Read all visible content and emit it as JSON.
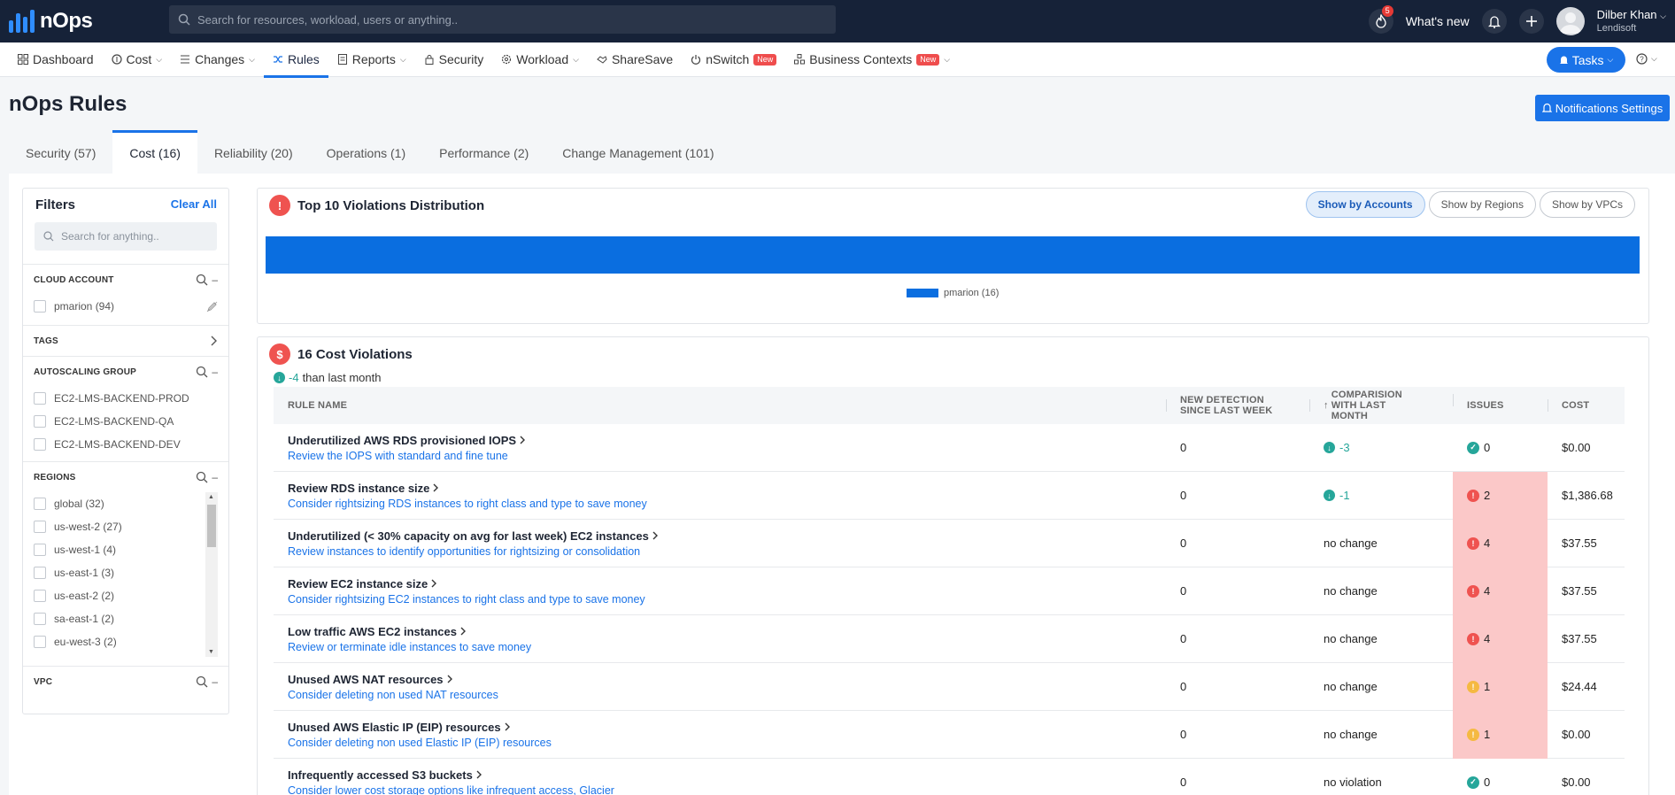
{
  "topbar": {
    "brand": "nOps",
    "search_placeholder": "Search for resources, workload, users or anything..",
    "notifications_count": "5",
    "whats_new": "What's new",
    "user_name": "Dilber Khan",
    "user_org": "Lendisoft"
  },
  "nav": {
    "items": [
      {
        "label": "Dashboard",
        "icon": "grid-icon"
      },
      {
        "label": "Cost",
        "icon": "coin-icon"
      },
      {
        "label": "Changes",
        "icon": "list-icon"
      },
      {
        "label": "Rules",
        "icon": "shuffle-icon"
      },
      {
        "label": "Reports",
        "icon": "report-icon"
      },
      {
        "label": "Security",
        "icon": "lock-icon"
      },
      {
        "label": "Workload",
        "icon": "gear-icon"
      },
      {
        "label": "ShareSave",
        "icon": "handshake-icon"
      },
      {
        "label": "nSwitch",
        "icon": "power-icon"
      },
      {
        "label": "Business Contexts",
        "icon": "cluster-icon"
      }
    ],
    "new_badge": "New",
    "tasks_label": "Tasks"
  },
  "page": {
    "title": "nOps Rules",
    "notifications_settings": "Notifications Settings"
  },
  "tabs": [
    {
      "label": "Security (57)"
    },
    {
      "label": "Cost (16)"
    },
    {
      "label": "Reliability (20)"
    },
    {
      "label": "Operations (1)"
    },
    {
      "label": "Performance (2)"
    },
    {
      "label": "Change Management (101)"
    }
  ],
  "filters": {
    "title": "Filters",
    "clear_all": "Clear All",
    "search_placeholder": "Search for anything..",
    "cloud_account": {
      "title": "CLOUD ACCOUNT",
      "items": [
        "pmarion (94)"
      ]
    },
    "tags": {
      "title": "TAGS"
    },
    "autoscaling": {
      "title": "AUTOSCALING GROUP",
      "items": [
        "EC2-LMS-BACKEND-PROD",
        "EC2-LMS-BACKEND-QA",
        "EC2-LMS-BACKEND-DEV"
      ]
    },
    "regions": {
      "title": "REGIONS",
      "items": [
        "global (32)",
        "us-west-2 (27)",
        "us-west-1 (4)",
        "us-east-1 (3)",
        "us-east-2 (2)",
        "sa-east-1 (2)",
        "eu-west-3 (2)"
      ]
    },
    "vpc": {
      "title": "VPC"
    }
  },
  "distribution": {
    "title": "Top 10 Violations Distribution",
    "toggles": [
      "Show by Accounts",
      "Show by Regions",
      "Show by VPCs"
    ],
    "legend_label": "pmarion (16)",
    "chart_data": {
      "type": "bar",
      "categories": [
        "pmarion"
      ],
      "values": [
        16
      ],
      "color": "#0a6ee0"
    }
  },
  "violations": {
    "title": "16 Cost Violations",
    "delta": "-4",
    "delta_text": "than last month",
    "columns": {
      "rule": "RULE NAME",
      "new_detection": "NEW DETECTION SINCE LAST WEEK",
      "comparison": "COMPARISION WITH LAST MONTH",
      "issues": "ISSUES",
      "cost": "COST"
    },
    "rows": [
      {
        "name": "Underutilized AWS RDS provisioned IOPS",
        "desc": "Review the IOPS with standard and fine tune",
        "new": "0",
        "cmp": "-3",
        "issues": "0",
        "status": "ok",
        "cost": "$0.00"
      },
      {
        "name": "Review RDS instance size",
        "desc": "Consider rightsizing RDS instances to right class and type to save money",
        "new": "0",
        "cmp": "-1",
        "issues": "2",
        "status": "err",
        "cost": "$1,386.68"
      },
      {
        "name": "Underutilized (< 30% capacity on avg for last week) EC2 instances",
        "desc": "Review instances to identify opportunities for rightsizing or consolidation",
        "new": "0",
        "cmp": "no change",
        "issues": "4",
        "status": "err",
        "cost": "$37.55"
      },
      {
        "name": "Review EC2 instance size",
        "desc": "Consider rightsizing EC2 instances to right class and type to save money",
        "new": "0",
        "cmp": "no change",
        "issues": "4",
        "status": "err",
        "cost": "$37.55"
      },
      {
        "name": "Low traffic AWS EC2 instances",
        "desc": "Review or terminate idle instances to save money",
        "new": "0",
        "cmp": "no change",
        "issues": "4",
        "status": "err",
        "cost": "$37.55"
      },
      {
        "name": "Unused AWS NAT resources",
        "desc": "Consider deleting non used NAT resources",
        "new": "0",
        "cmp": "no change",
        "issues": "1",
        "status": "warn",
        "cost": "$24.44"
      },
      {
        "name": "Unused AWS Elastic IP (EIP) resources",
        "desc": "Consider deleting non used Elastic IP (EIP) resources",
        "new": "0",
        "cmp": "no change",
        "issues": "1",
        "status": "warn",
        "cost": "$0.00"
      },
      {
        "name": "Infrequently accessed S3 buckets",
        "desc": "Consider lower cost storage options like infrequent access, Glacier",
        "new": "0",
        "cmp": "no violation",
        "issues": "0",
        "status": "ok",
        "cost": "$0.00"
      }
    ]
  },
  "colors": {
    "accent": "#1a73e8",
    "topbar": "#162238",
    "error": "#ef5350",
    "ok": "#26a69a",
    "warn": "#f5b942",
    "issue_highlight": "#fbc8c8"
  }
}
